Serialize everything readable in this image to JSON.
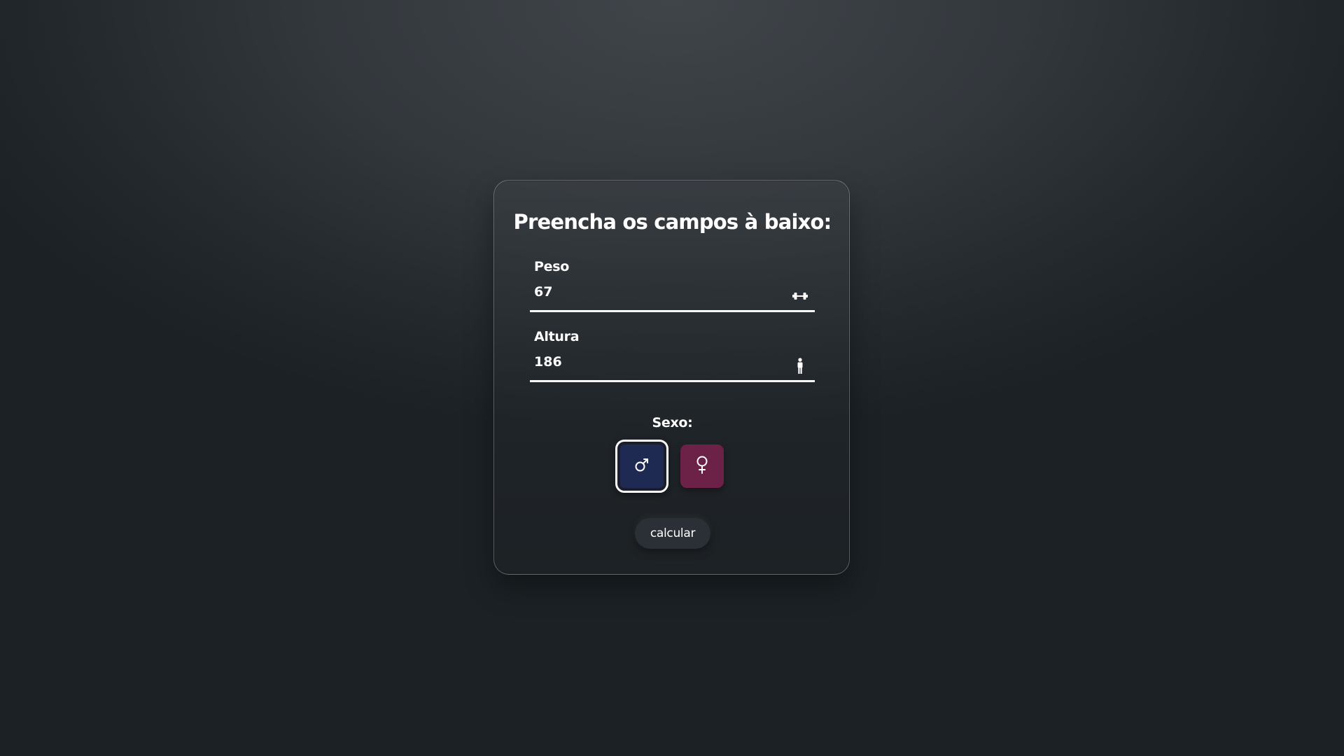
{
  "form": {
    "title": "Preencha os campos à baixo:",
    "peso": {
      "label": "Peso",
      "value": "67",
      "icon": "dumbbell-icon"
    },
    "altura": {
      "label": "Altura",
      "value": "186",
      "icon": "person-standing-icon"
    },
    "sexo": {
      "label": "Sexo:",
      "options": [
        {
          "name": "male",
          "icon": "male-symbol-icon",
          "selected": true,
          "color": "#1f2a52"
        },
        {
          "name": "female",
          "icon": "female-symbol-icon",
          "selected": false,
          "color": "#6c2147"
        }
      ]
    },
    "submit_label": "calcular"
  }
}
